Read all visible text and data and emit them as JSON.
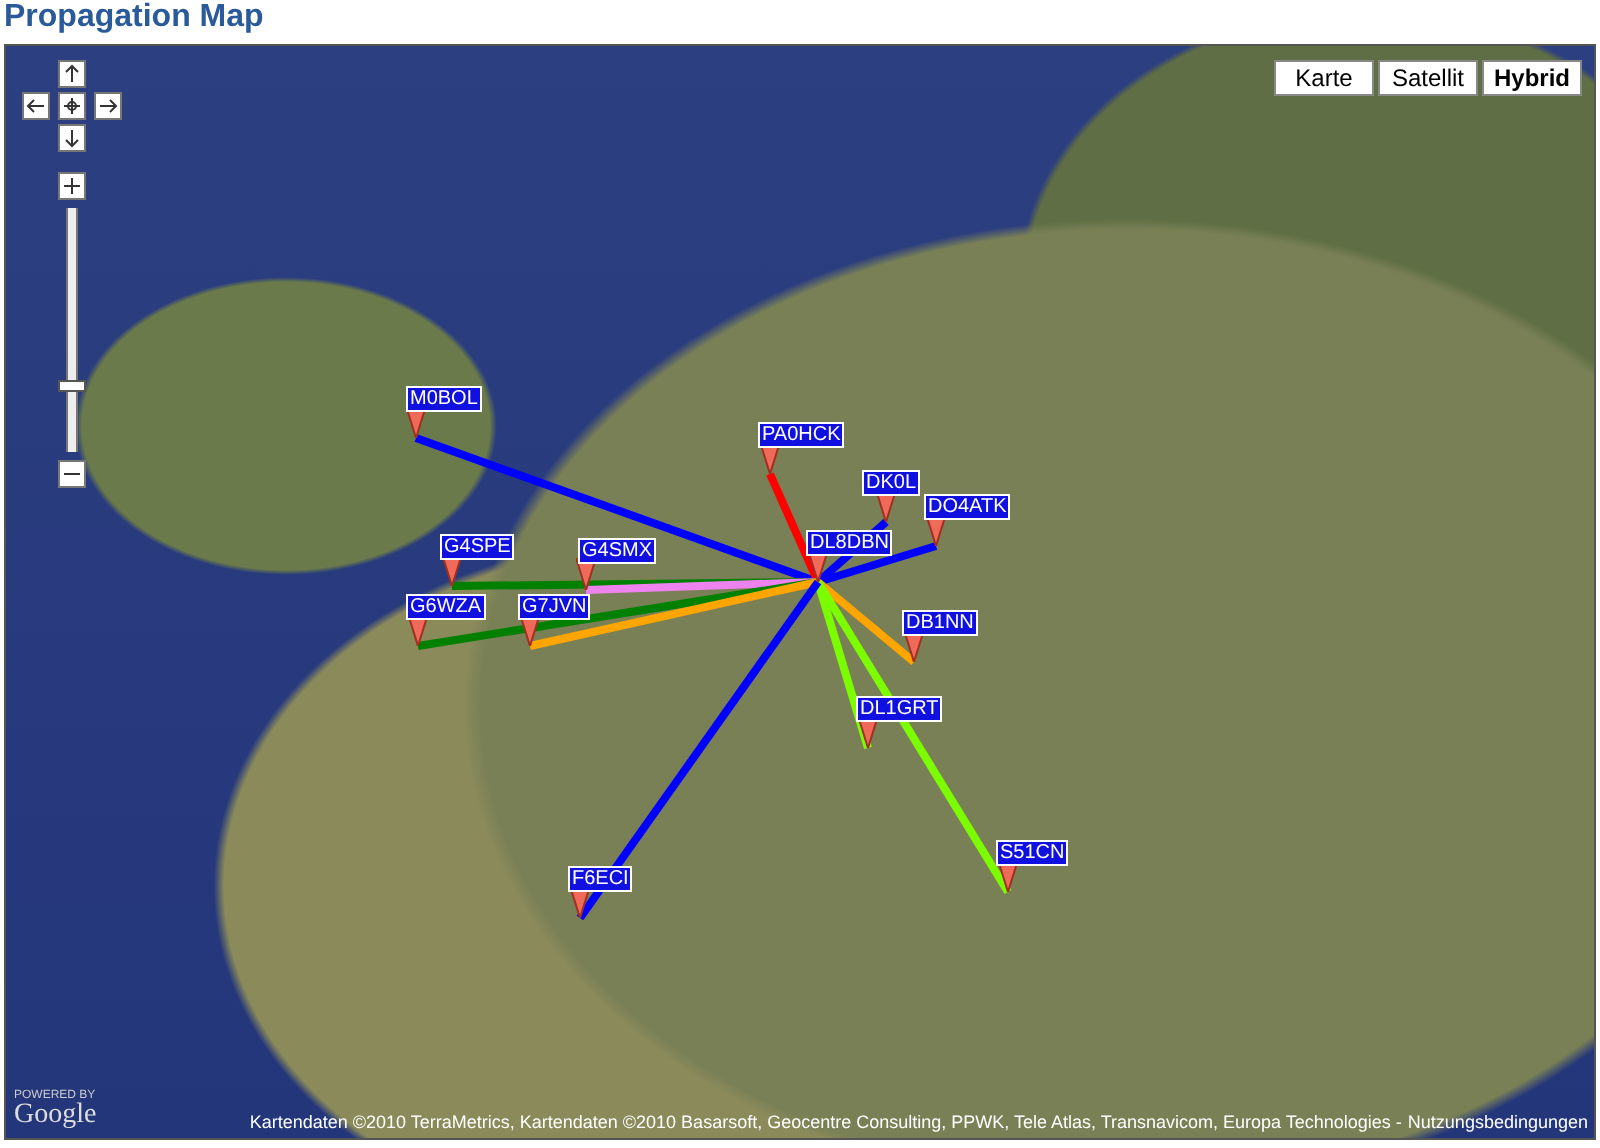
{
  "title": "Propagation Map",
  "map_types": [
    {
      "label": "Karte",
      "selected": false
    },
    {
      "label": "Satellit",
      "selected": false
    },
    {
      "label": "Hybrid",
      "selected": true
    }
  ],
  "zoom": {
    "level": 0.26
  },
  "stations": [
    {
      "callsign": "M0BOL",
      "color": "#0000ff"
    },
    {
      "callsign": "PA0HCK",
      "color": "#ff0000"
    },
    {
      "callsign": "DK0L",
      "color": "#0000ff"
    },
    {
      "callsign": "DO4ATK",
      "color": "#0000ff"
    },
    {
      "callsign": "G4SPE",
      "color": "#008000"
    },
    {
      "callsign": "G4SMX",
      "color": "#ee82ee"
    },
    {
      "callsign": "DL8DBN"
    },
    {
      "callsign": "G6WZA",
      "color": "#008000"
    },
    {
      "callsign": "G7JVN",
      "color": "#ffa500"
    },
    {
      "callsign": "DB1NN",
      "color": "#ffa500"
    },
    {
      "callsign": "DL1GRT",
      "color": "#7cfc00"
    },
    {
      "callsign": "S51CN",
      "color": "#7cfc00"
    },
    {
      "callsign": "F6ECI",
      "color": "#0000ff"
    }
  ],
  "logo": {
    "small": "POWERED BY",
    "name": "Google"
  },
  "attribution": {
    "text": "Kartendaten ©2010 TerraMetrics, Kartendaten ©2010 Basarsoft, Geocentre Consulting, PPWK, Tele Atlas, Transnavicom, Europa Technologies -",
    "link": "Nutzungsbedingungen"
  }
}
